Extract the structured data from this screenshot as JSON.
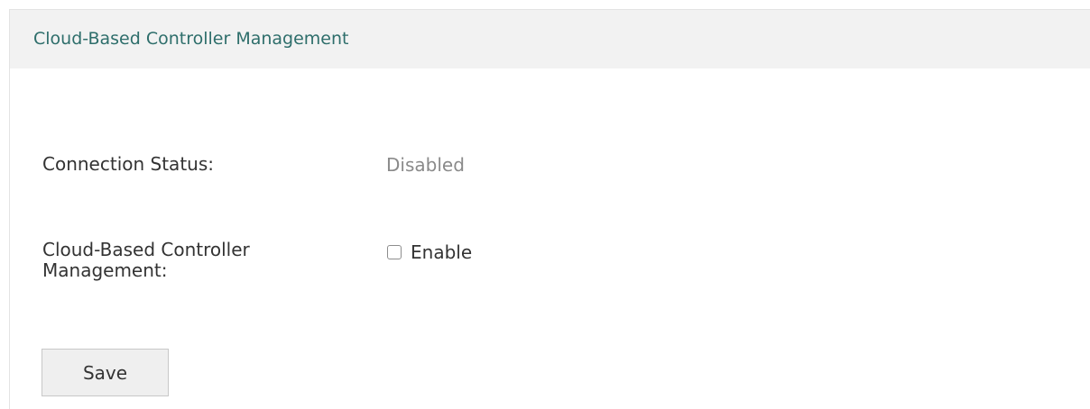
{
  "panel": {
    "title": "Cloud-Based Controller Management"
  },
  "fields": {
    "connection_status": {
      "label": "Connection Status:",
      "value": "Disabled"
    },
    "cloud_management": {
      "label_line1": "Cloud-Based Controller",
      "label_line2": "Management:",
      "checkbox_label": "Enable",
      "checked": false
    }
  },
  "actions": {
    "save_label": "Save"
  },
  "colors": {
    "title": "#2e6e6b",
    "header_bg": "#f2f2f2",
    "status_value": "#8a8a8a"
  }
}
